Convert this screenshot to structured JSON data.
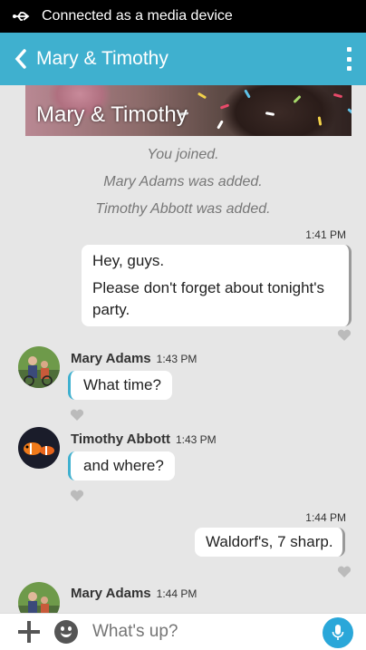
{
  "status_bar": {
    "text": "Connected as a media device",
    "icon": "usb-icon"
  },
  "header": {
    "title": "Mary & Timothy",
    "back_icon": "chevron-left-icon",
    "menu_icon": "overflow-menu-icon"
  },
  "banner": {
    "title": "Mary & Timothy"
  },
  "system_messages": [
    "You joined.",
    "Mary Adams was added.",
    "Timothy Abbott was added."
  ],
  "messages": [
    {
      "direction": "outgoing",
      "time": "1:41 PM",
      "lines": [
        "Hey, guys.",
        "Please don't forget about tonight's party."
      ]
    },
    {
      "direction": "incoming",
      "sender": "Mary Adams",
      "time": "1:43 PM",
      "text": "What time?"
    },
    {
      "direction": "incoming",
      "sender": "Timothy Abbott",
      "time": "1:43 PM",
      "text": "and where?"
    },
    {
      "direction": "outgoing",
      "time": "1:44 PM",
      "text": "Waldorf's, 7 sharp."
    },
    {
      "direction": "incoming",
      "sender": "Mary Adams",
      "time": "1:44 PM"
    }
  ],
  "composer": {
    "placeholder": "What's up?",
    "add_icon": "plus-icon",
    "emoji_icon": "emoji-icon",
    "mic_icon": "microphone-icon"
  },
  "colors": {
    "accent": "#3fb0cf",
    "mic": "#2aa7d9",
    "background": "#e6e6e6"
  }
}
